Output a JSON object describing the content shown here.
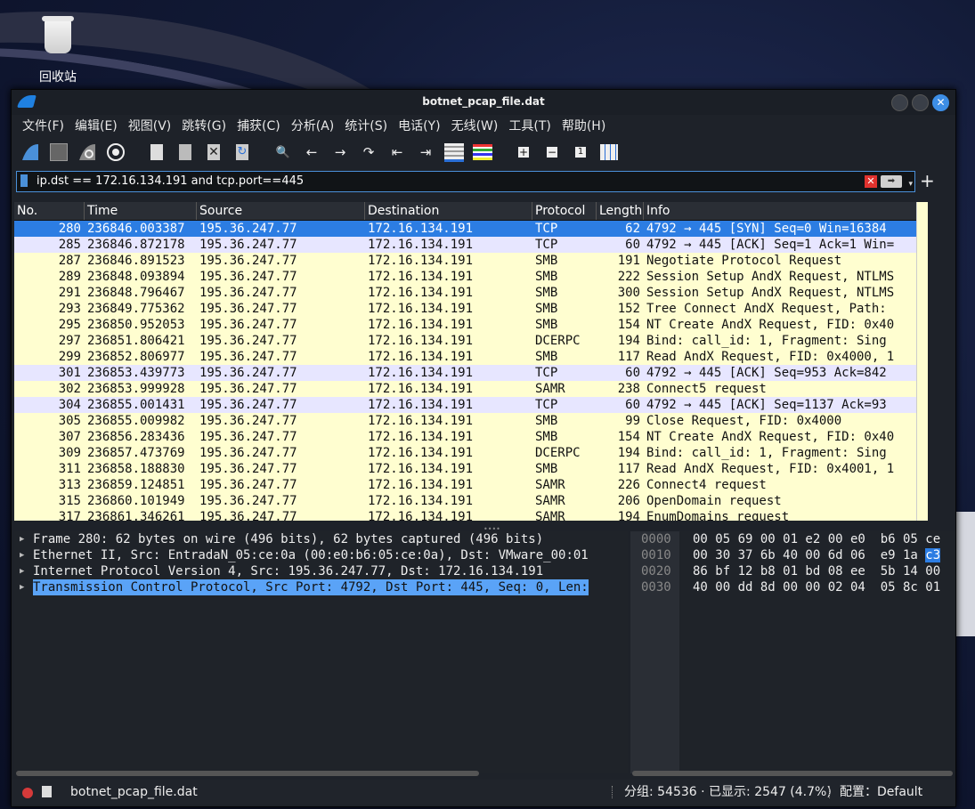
{
  "desktop": {
    "recycle_bin_label": "回收站"
  },
  "window": {
    "title": "botnet_pcap_file.dat",
    "close_glyph": "✕"
  },
  "menu": [
    "文件(F)",
    "编辑(E)",
    "视图(V)",
    "跳转(G)",
    "捕获(C)",
    "分析(A)",
    "统计(S)",
    "电话(Y)",
    "无线(W)",
    "工具(T)",
    "帮助(H)"
  ],
  "toolbar": {
    "icons": [
      "shark-fin-start-icon",
      "stop-capture-icon",
      "restart-capture-icon",
      "capture-options-icon",
      "open-file-icon",
      "save-file-icon",
      "close-file-icon",
      "reload-file-icon",
      "find-packet-icon",
      "go-back-icon",
      "go-forward-icon",
      "go-to-packet-icon",
      "first-packet-icon",
      "last-packet-icon",
      "autoscroll-icon",
      "colorize-icon",
      "zoom-in-icon",
      "zoom-out-icon",
      "normal-size-icon",
      "resize-columns-icon"
    ],
    "glyphs": {
      "find": "🔍",
      "back": "←",
      "forward": "→",
      "goto": "↷",
      "first": "⇤",
      "last": "⇥",
      "zoom_in": "+",
      "zoom_out": "−",
      "normal": "1"
    }
  },
  "filter": {
    "value": "ip.dst == 172.16.134.191 and tcp.port==445",
    "apply_glyph": "➡",
    "clear_glyph": "✕",
    "dropdown_glyph": "▾",
    "add_glyph": "+"
  },
  "packet_list": {
    "columns": [
      "No.",
      "Time",
      "Source",
      "Destination",
      "Protocol",
      "Length",
      "Info"
    ],
    "rows": [
      {
        "no": "280",
        "time": "236846.003387",
        "src": "195.36.247.77",
        "dst": "172.16.134.191",
        "proto": "TCP",
        "len": "62",
        "info": "4792 → 445 [SYN] Seq=0 Win=16384"
      },
      {
        "no": "285",
        "time": "236846.872178",
        "src": "195.36.247.77",
        "dst": "172.16.134.191",
        "proto": "TCP",
        "len": "60",
        "info": "4792 → 445 [ACK] Seq=1 Ack=1 Win="
      },
      {
        "no": "287",
        "time": "236846.891523",
        "src": "195.36.247.77",
        "dst": "172.16.134.191",
        "proto": "SMB",
        "len": "191",
        "info": "Negotiate Protocol Request"
      },
      {
        "no": "289",
        "time": "236848.093894",
        "src": "195.36.247.77",
        "dst": "172.16.134.191",
        "proto": "SMB",
        "len": "222",
        "info": "Session Setup AndX Request, NTLMS"
      },
      {
        "no": "291",
        "time": "236848.796467",
        "src": "195.36.247.77",
        "dst": "172.16.134.191",
        "proto": "SMB",
        "len": "300",
        "info": "Session Setup AndX Request, NTLMS"
      },
      {
        "no": "293",
        "time": "236849.775362",
        "src": "195.36.247.77",
        "dst": "172.16.134.191",
        "proto": "SMB",
        "len": "152",
        "info": "Tree Connect AndX Request, Path:"
      },
      {
        "no": "295",
        "time": "236850.952053",
        "src": "195.36.247.77",
        "dst": "172.16.134.191",
        "proto": "SMB",
        "len": "154",
        "info": "NT Create AndX Request, FID: 0x40"
      },
      {
        "no": "297",
        "time": "236851.806421",
        "src": "195.36.247.77",
        "dst": "172.16.134.191",
        "proto": "DCERPC",
        "len": "194",
        "info": "Bind: call_id: 1, Fragment: Sing"
      },
      {
        "no": "299",
        "time": "236852.806977",
        "src": "195.36.247.77",
        "dst": "172.16.134.191",
        "proto": "SMB",
        "len": "117",
        "info": "Read AndX Request, FID: 0x4000, 1"
      },
      {
        "no": "301",
        "time": "236853.439773",
        "src": "195.36.247.77",
        "dst": "172.16.134.191",
        "proto": "TCP",
        "len": "60",
        "info": "4792 → 445 [ACK] Seq=953 Ack=842"
      },
      {
        "no": "302",
        "time": "236853.999928",
        "src": "195.36.247.77",
        "dst": "172.16.134.191",
        "proto": "SAMR",
        "len": "238",
        "info": "Connect5 request"
      },
      {
        "no": "304",
        "time": "236855.001431",
        "src": "195.36.247.77",
        "dst": "172.16.134.191",
        "proto": "TCP",
        "len": "60",
        "info": "4792 → 445 [ACK] Seq=1137 Ack=93"
      },
      {
        "no": "305",
        "time": "236855.009982",
        "src": "195.36.247.77",
        "dst": "172.16.134.191",
        "proto": "SMB",
        "len": "99",
        "info": "Close Request, FID: 0x4000"
      },
      {
        "no": "307",
        "time": "236856.283436",
        "src": "195.36.247.77",
        "dst": "172.16.134.191",
        "proto": "SMB",
        "len": "154",
        "info": "NT Create AndX Request, FID: 0x40"
      },
      {
        "no": "309",
        "time": "236857.473769",
        "src": "195.36.247.77",
        "dst": "172.16.134.191",
        "proto": "DCERPC",
        "len": "194",
        "info": "Bind: call_id: 1, Fragment: Sing"
      },
      {
        "no": "311",
        "time": "236858.188830",
        "src": "195.36.247.77",
        "dst": "172.16.134.191",
        "proto": "SMB",
        "len": "117",
        "info": "Read AndX Request, FID: 0x4001, 1"
      },
      {
        "no": "313",
        "time": "236859.124851",
        "src": "195.36.247.77",
        "dst": "172.16.134.191",
        "proto": "SAMR",
        "len": "226",
        "info": "Connect4 request"
      },
      {
        "no": "315",
        "time": "236860.101949",
        "src": "195.36.247.77",
        "dst": "172.16.134.191",
        "proto": "SAMR",
        "len": "206",
        "info": "OpenDomain request"
      },
      {
        "no": "317",
        "time": "236861.346261",
        "src": "195.36.247.77",
        "dst": "172.16.134.191",
        "proto": "SAMR",
        "len": "194",
        "info": "EnumDomains request"
      }
    ]
  },
  "detail_tree": [
    {
      "text": "Frame 280: 62 bytes on wire (496 bits), 62 bytes captured (496 bits)",
      "arrow": "▶"
    },
    {
      "text": "Ethernet II, Src: EntradaN_05:ce:0a (00:e0:b6:05:ce:0a), Dst: VMware_00:01",
      "arrow": "▶"
    },
    {
      "text": "Internet Protocol Version 4, Src: 195.36.247.77, Dst: 172.16.134.191",
      "arrow": "▶"
    },
    {
      "text": "Transmission Control Protocol, Src Port: 4792, Dst Port: 445, Seq: 0, Len:",
      "arrow": "▶"
    }
  ],
  "hex_dump": {
    "offsets": [
      "0000",
      "0010",
      "0020",
      "0030"
    ],
    "lines": [
      {
        "pre": "00 05 69 00 01 e2 00 e0  b6 05 ce",
        "hl": ""
      },
      {
        "pre": "00 30 37 6b 40 00 6d 06  e9 1a ",
        "hl": "c3"
      },
      {
        "pre": "86 bf 12 b8 01 bd 08 ee  5b 14 00",
        "hl": ""
      },
      {
        "pre": "40 00 dd 8d 00 00 02 04  05 8c 01",
        "hl": ""
      }
    ]
  },
  "status": {
    "file": "botnet_pcap_file.dat",
    "stats": "分组: 54536 · 已显示: 2547 (4.7%)",
    "profile": "配置：Default"
  }
}
